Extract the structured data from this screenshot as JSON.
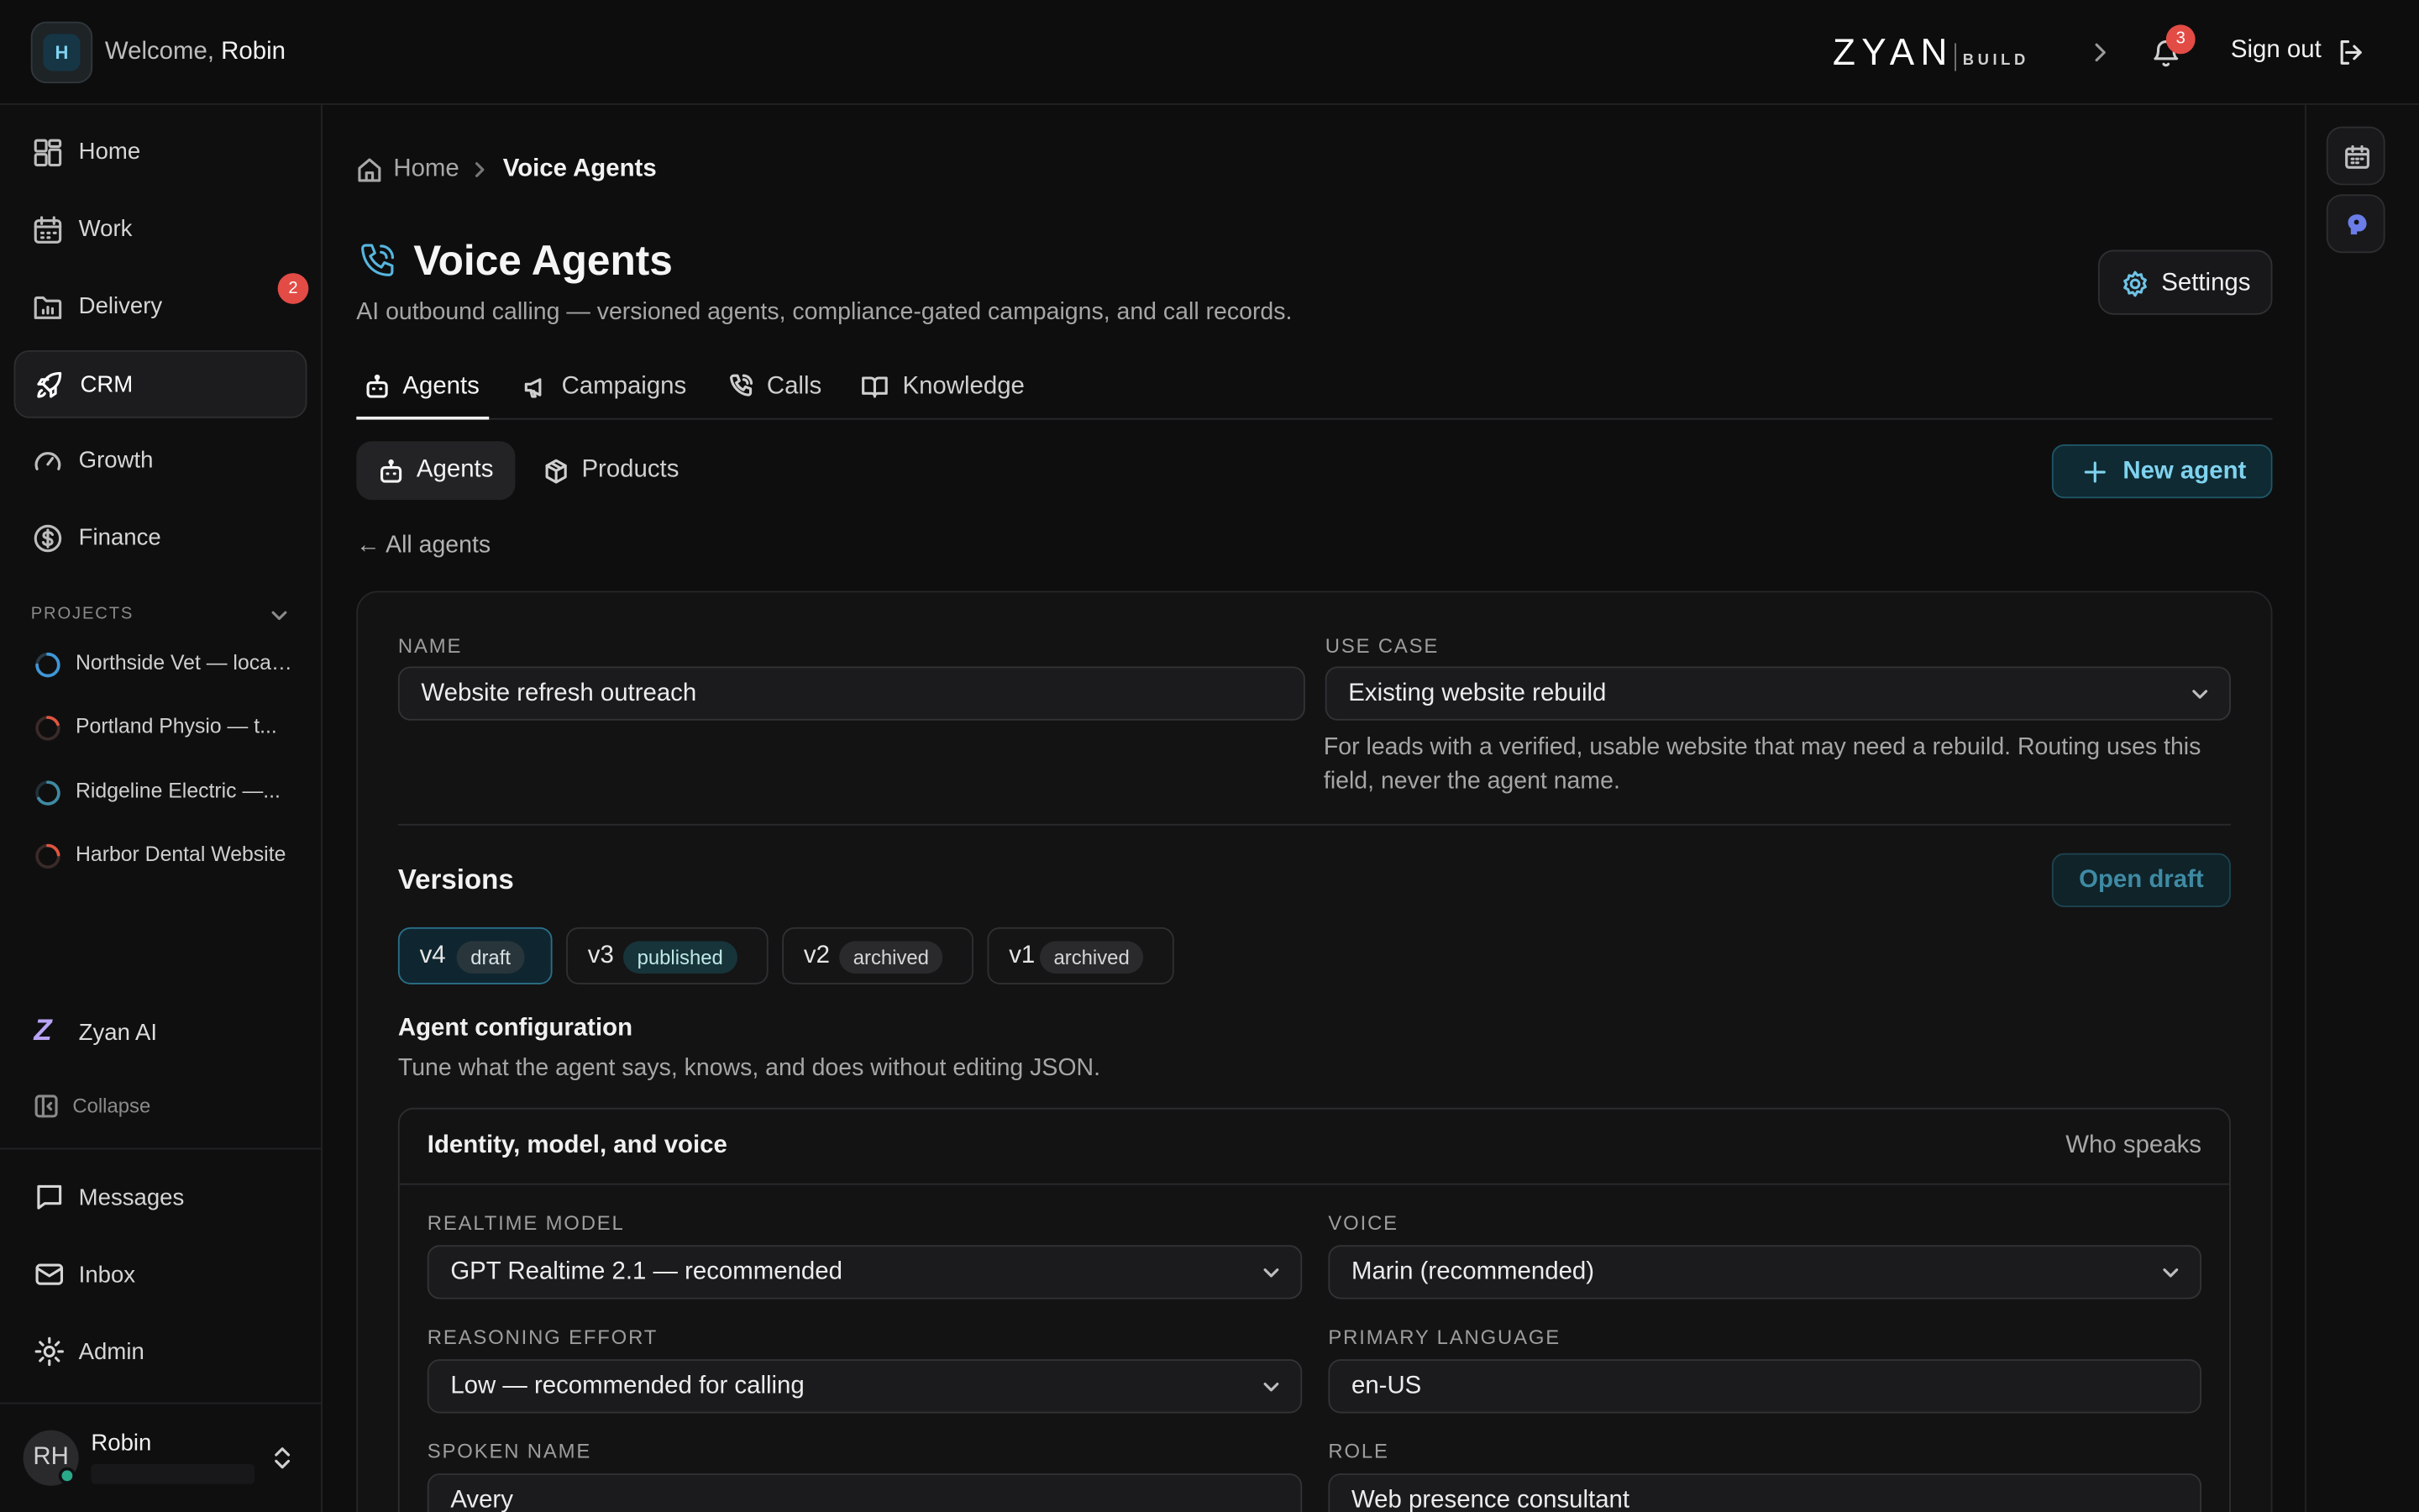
{
  "topbar": {
    "avatar_letter": "H",
    "welcome_prefix": "Welcome, ",
    "welcome_name": "Robin",
    "brand_main": "ZYAN",
    "brand_sub": "BUILD",
    "notification_count": "3",
    "sign_out": "Sign out"
  },
  "sidebar": {
    "nav": [
      {
        "label": "Home",
        "icon": "dashboard-icon"
      },
      {
        "label": "Work",
        "icon": "calendar-icon"
      },
      {
        "label": "Delivery",
        "icon": "folder-chart-icon",
        "badge": "2"
      },
      {
        "label": "CRM",
        "icon": "rocket-icon",
        "active": true
      },
      {
        "label": "Growth",
        "icon": "gauge-icon"
      },
      {
        "label": "Finance",
        "icon": "dollar-circle-icon"
      }
    ],
    "projects_heading": "PROJECTS",
    "projects": [
      {
        "label": "Northside Vet — local SEO",
        "ring_color": "#3f97d6"
      },
      {
        "label": "Portland Physio — t...",
        "ring_color": "#e0553f"
      },
      {
        "label": "Ridgeline Electric —...",
        "ring_color": "#3f8aa3"
      },
      {
        "label": "Harbor Dental Website",
        "ring_color": "#e0553f"
      }
    ],
    "zyan_ai": "Zyan AI",
    "collapse": "Collapse",
    "bottom_nav": [
      {
        "label": "Messages",
        "icon": "message-icon"
      },
      {
        "label": "Inbox",
        "icon": "mail-icon"
      },
      {
        "label": "Admin",
        "icon": "gear-icon"
      }
    ],
    "user": {
      "initials": "RH",
      "name": "Robin"
    }
  },
  "breadcrumb": {
    "home": "Home",
    "current": "Voice Agents"
  },
  "page": {
    "title": "Voice Agents",
    "subtitle": "AI outbound calling — versioned agents, compliance-gated campaigns, and call records.",
    "settings": "Settings"
  },
  "tabs": [
    {
      "label": "Agents",
      "active": true
    },
    {
      "label": "Campaigns"
    },
    {
      "label": "Calls"
    },
    {
      "label": "Knowledge"
    }
  ],
  "subtabs": [
    {
      "label": "Agents",
      "active": true
    },
    {
      "label": "Products"
    }
  ],
  "new_agent": "New agent",
  "back_link": "← All agents",
  "form": {
    "name_label": "NAME",
    "name_value": "Website refresh outreach",
    "use_case_label": "USE CASE",
    "use_case_value": "Existing website rebuild",
    "use_case_help": "For leads with a verified, usable website that may need a rebuild. Routing uses this field, never the agent name."
  },
  "versions": {
    "title": "Versions",
    "open_draft": "Open draft",
    "items": [
      {
        "name": "v4",
        "status": "draft",
        "active": true
      },
      {
        "name": "v3",
        "status": "published"
      },
      {
        "name": "v2",
        "status": "archived"
      },
      {
        "name": "v1",
        "status": "archived"
      }
    ]
  },
  "config": {
    "title": "Agent configuration",
    "subtitle": "Tune what the agent says, knows, and does without editing JSON.",
    "section_title": "Identity, model, and voice",
    "section_right": "Who speaks",
    "realtime_model_label": "REALTIME MODEL",
    "realtime_model_value": "GPT Realtime 2.1 — recommended",
    "voice_label": "VOICE",
    "voice_value": "Marin (recommended)",
    "reasoning_label": "REASONING EFFORT",
    "reasoning_value": "Low — recommended for calling",
    "language_label": "PRIMARY LANGUAGE",
    "language_value": "en-US",
    "spoken_name_label": "SPOKEN NAME",
    "spoken_name_value": "Avery",
    "role_label": "ROLE",
    "role_value": "Web presence consultant"
  },
  "colors": {
    "accent": "#57b6df",
    "badge_red": "#e34b45",
    "background": "#0e0e0f"
  }
}
